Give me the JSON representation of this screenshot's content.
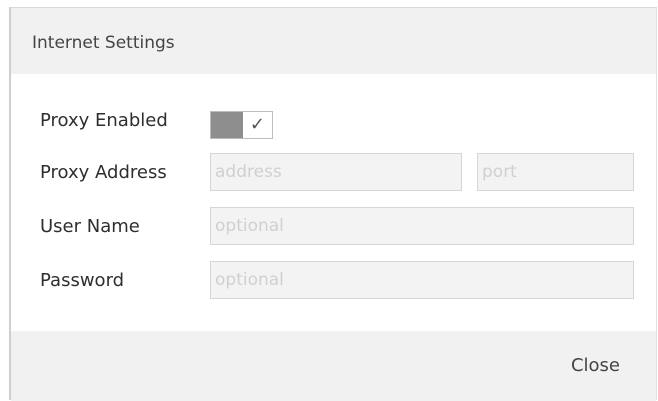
{
  "dialog": {
    "title": "Internet Settings",
    "close_label": "Close"
  },
  "proxy_enabled": {
    "label": "Proxy Enabled",
    "checked": true,
    "check_glyph": "✓"
  },
  "proxy_address": {
    "label": "Proxy Address",
    "address_placeholder": "address",
    "port_placeholder": "port"
  },
  "user_name": {
    "label": "User Name",
    "placeholder": "optional"
  },
  "password": {
    "label": "Password",
    "placeholder": "optional"
  }
}
